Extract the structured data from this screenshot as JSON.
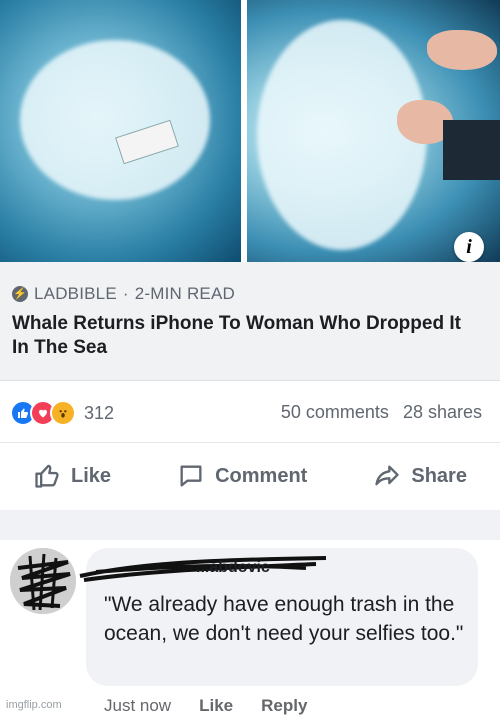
{
  "hero": {
    "info_glyph": "i"
  },
  "link_preview": {
    "source": "LADBIBLE",
    "separator": "·",
    "read_time": "2-MIN READ",
    "headline": "Whale Returns iPhone To Woman Who Dropped It In The Sea"
  },
  "stats": {
    "reaction_count": "312",
    "comments": "50 comments",
    "shares": "28 shares",
    "reaction_icons": [
      "like-icon",
      "love-icon",
      "wow-icon"
    ]
  },
  "actions": {
    "like": "Like",
    "comment": "Comment",
    "share": "Share"
  },
  "comment": {
    "author": "...abdovic",
    "text": "\"We already have enough trash in the ocean, we don't need your selfies too.\"",
    "time": "Just now",
    "like": "Like",
    "reply": "Reply"
  },
  "watermark": "imgflip.com",
  "colors": {
    "facebook_blue": "#1877f2",
    "love_red": "#f33e58",
    "wow_yellow": "#f7b125",
    "muted_text": "#606770"
  }
}
